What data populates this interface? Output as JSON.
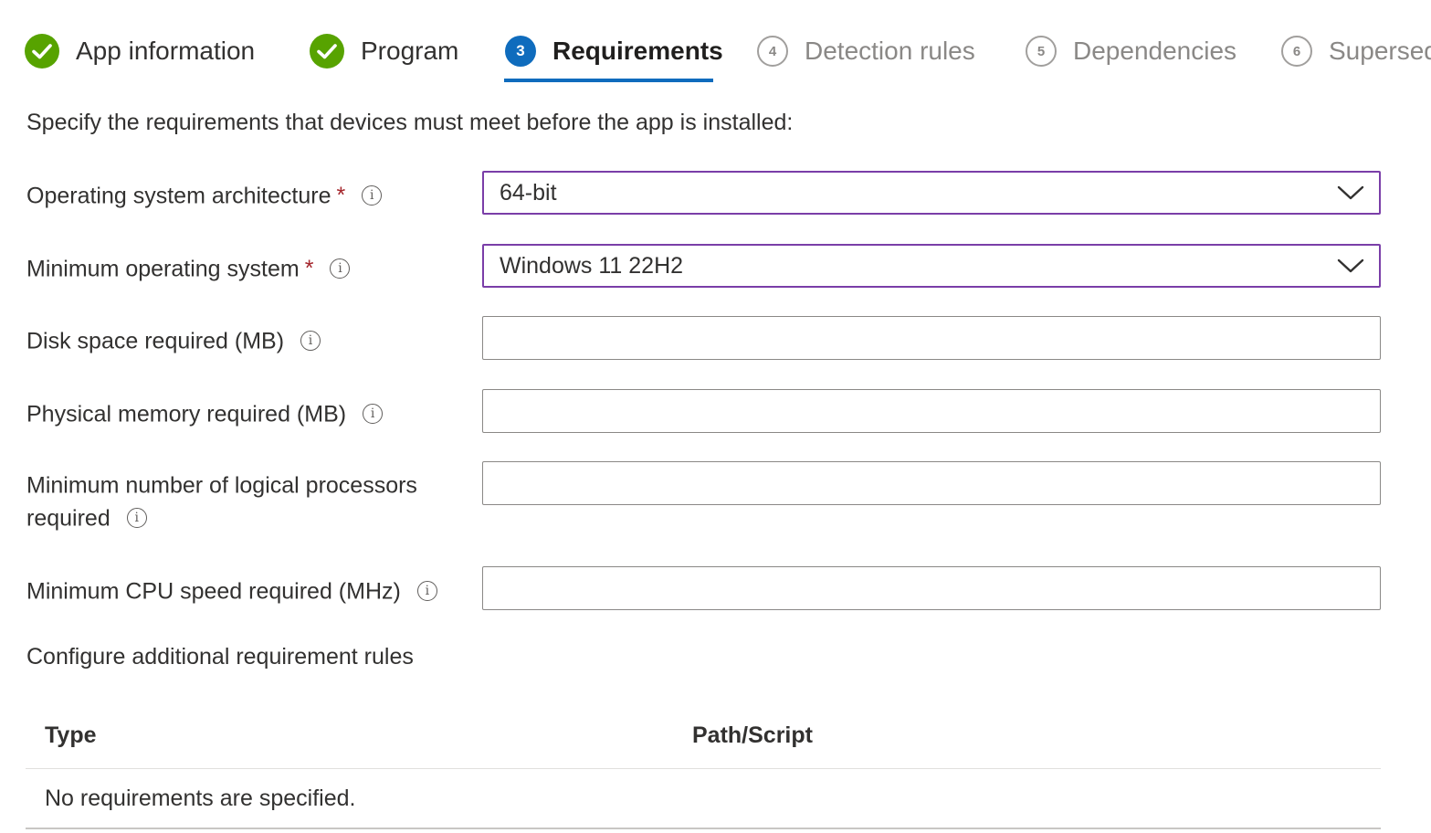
{
  "wizard": {
    "steps": [
      {
        "number": "1",
        "label": "App information",
        "state": "done",
        "icon": "checkmark-icon"
      },
      {
        "number": "2",
        "label": "Program",
        "state": "done",
        "icon": "checkmark-icon"
      },
      {
        "number": "3",
        "label": "Requirements",
        "state": "current"
      },
      {
        "number": "4",
        "label": "Detection rules",
        "state": "todo"
      },
      {
        "number": "5",
        "label": "Dependencies",
        "state": "todo"
      },
      {
        "number": "6",
        "label": "Supersedence",
        "state": "todo"
      }
    ],
    "colors": {
      "done": "#57a300",
      "current": "#0f6cbd",
      "todo": "#a19f9d"
    }
  },
  "intro": "Specify the requirements that devices must meet before the app is installed:",
  "form": {
    "os_architecture": {
      "label": "Operating system architecture",
      "required": "*",
      "value": "64-bit"
    },
    "min_os": {
      "label": "Minimum operating system",
      "required": "*",
      "value": "Windows 11 22H2"
    },
    "disk_space": {
      "label": "Disk space required (MB)",
      "value": ""
    },
    "physical_memory": {
      "label": "Physical memory required (MB)",
      "value": ""
    },
    "logical_processors": {
      "label_line1": "Minimum number of logical processors",
      "label_line2": "required",
      "value": ""
    },
    "cpu_speed": {
      "label": "Minimum CPU speed required (MHz)",
      "value": ""
    }
  },
  "additional_rules": {
    "title": "Configure additional requirement rules",
    "columns": [
      "Type",
      "Path/Script"
    ],
    "empty_message": "No requirements are specified."
  },
  "icons": {
    "info": "i"
  }
}
